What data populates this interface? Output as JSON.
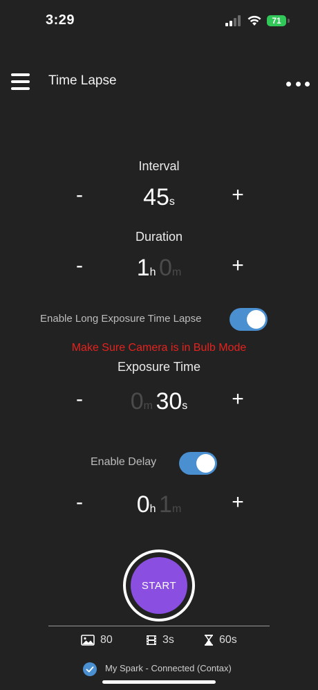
{
  "status": {
    "time": "3:29",
    "battery": "71"
  },
  "nav": {
    "title": "Time Lapse"
  },
  "interval": {
    "label": "Interval",
    "value": "45",
    "unit": "s",
    "minus": "-",
    "plus": "+"
  },
  "duration": {
    "label": "Duration",
    "hours": "1",
    "hours_unit": "h",
    "minutes": "0",
    "minutes_unit": "m",
    "minus": "-",
    "plus": "+"
  },
  "long_exposure": {
    "label": "Enable Long Exposure Time Lapse",
    "enabled": true,
    "warning": "Make Sure Camera is in Bulb Mode"
  },
  "exposure": {
    "label": "Exposure Time",
    "minutes": "0",
    "minutes_unit": "m",
    "seconds": "30",
    "seconds_unit": "s",
    "minus": "-",
    "plus": "+"
  },
  "delay": {
    "label": "Enable Delay",
    "enabled": true,
    "hours": "0",
    "hours_unit": "h",
    "minutes": "1",
    "minutes_unit": "m",
    "minus": "-",
    "plus": "+"
  },
  "start": {
    "label": "START"
  },
  "stats": {
    "photos": "80",
    "video_length": "3s",
    "total_time": "60s"
  },
  "footer": {
    "connection": "My Spark - Connected (Contax)"
  },
  "colors": {
    "accent": "#4a8fd0",
    "start": "#8a4fe0",
    "warning": "#e5221e",
    "background": "#222222"
  }
}
